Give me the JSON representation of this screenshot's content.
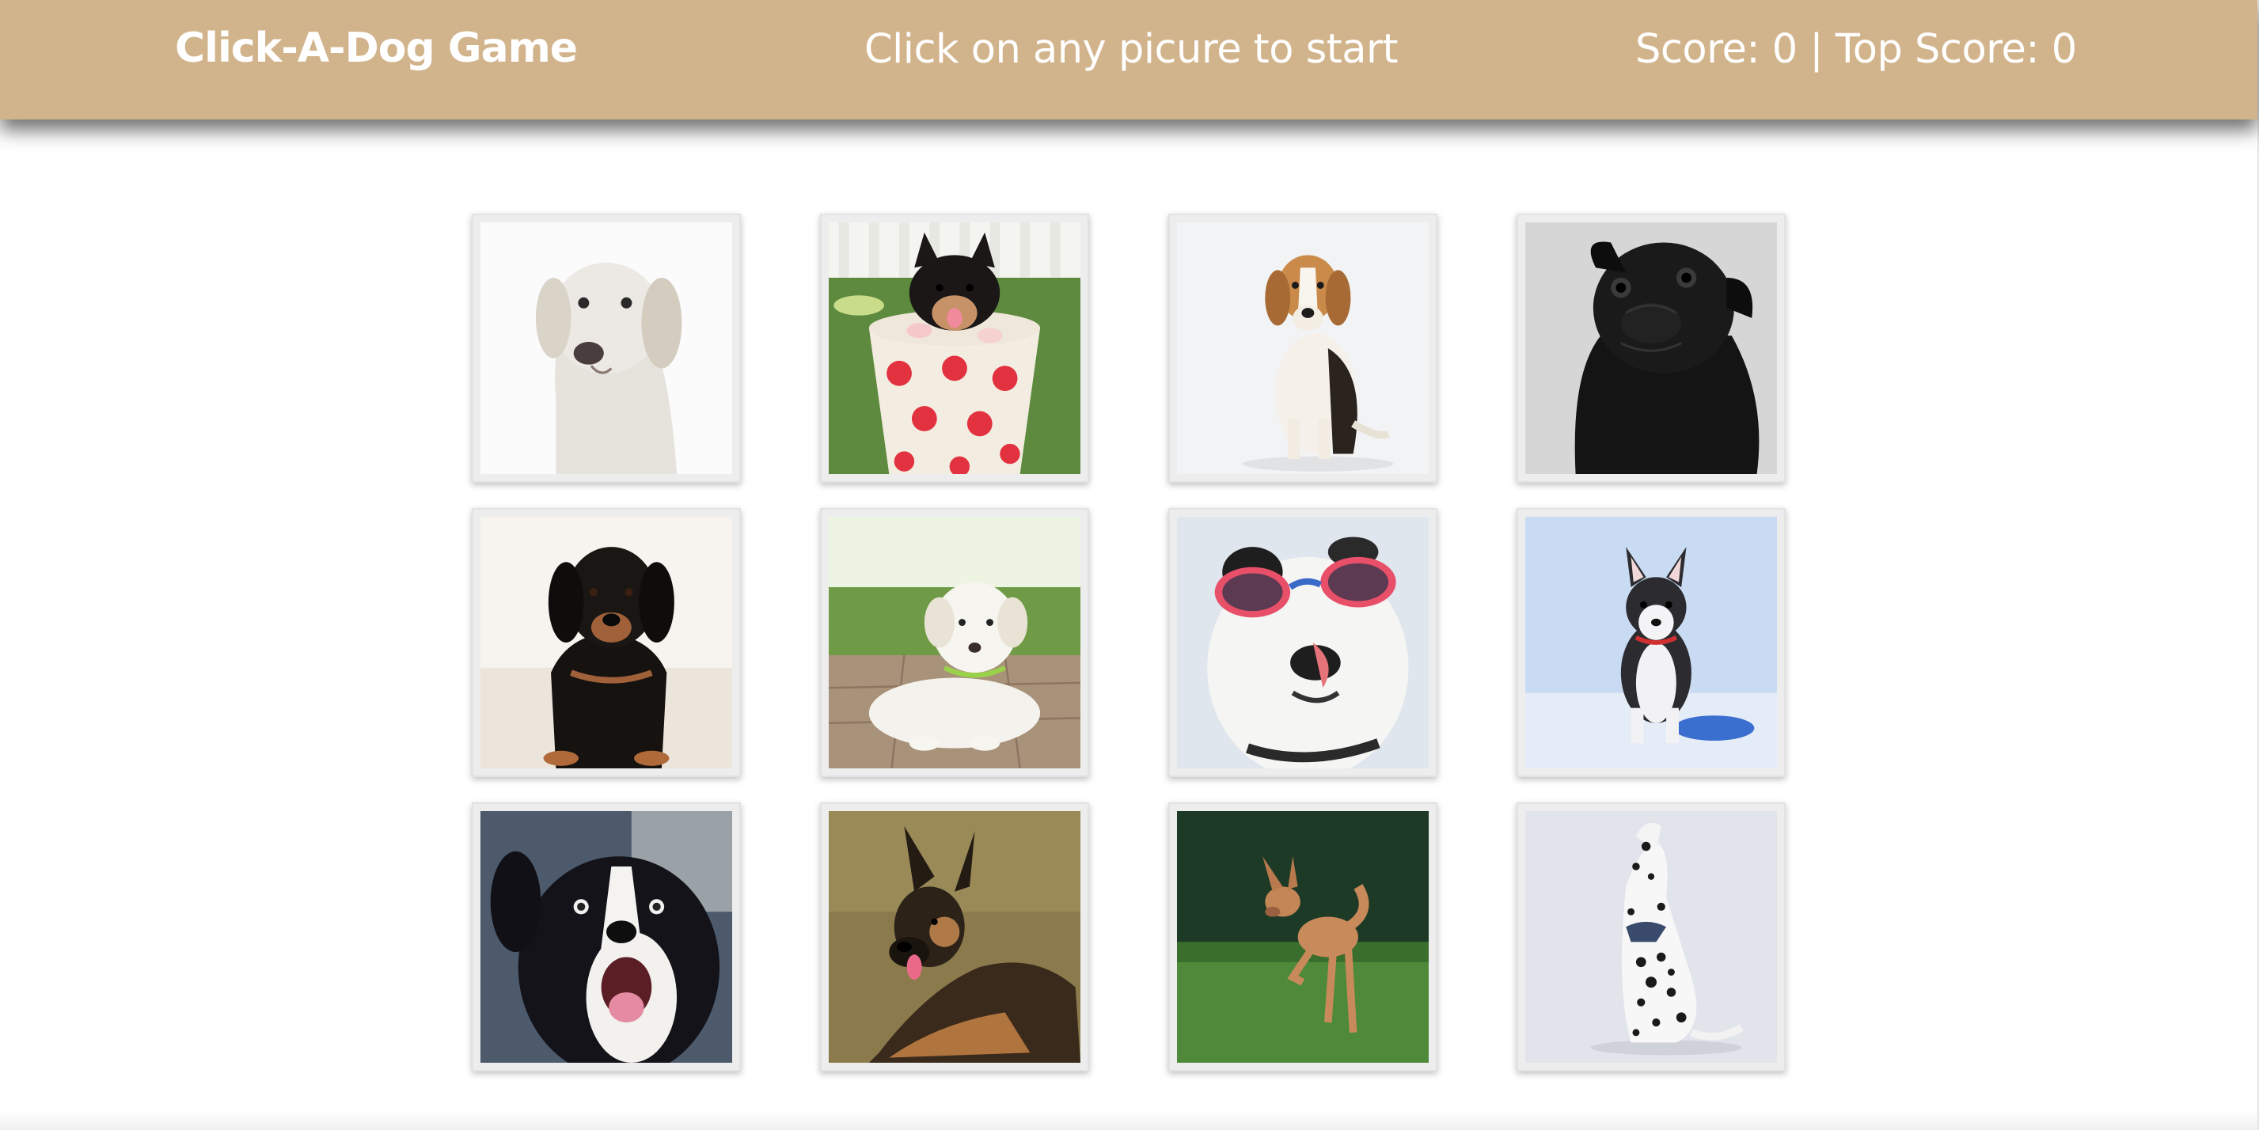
{
  "navbar": {
    "brand": "Click-A-Dog Game",
    "message": "Click on any picure to start",
    "score_label": "Score: 0 | Top Score: 0"
  },
  "colors": {
    "navbar_bg": "#d2b48c",
    "navbar_text": "#ffffff",
    "card_border": "#e2e2e2"
  },
  "cards": [
    {
      "icon": "golden-retriever-photo"
    },
    {
      "icon": "puppy-in-polka-dot-cup-photo"
    },
    {
      "icon": "beagle-photo"
    },
    {
      "icon": "black-pug-photo"
    },
    {
      "icon": "dachshund-puppy-photo"
    },
    {
      "icon": "white-labrador-puppy-photo"
    },
    {
      "icon": "dog-with-sunglasses-photo"
    },
    {
      "icon": "husky-puppy-in-snow-photo"
    },
    {
      "icon": "border-collie-photo"
    },
    {
      "icon": "german-shepherd-photo"
    },
    {
      "icon": "jumping-tan-dog-photo"
    },
    {
      "icon": "dalmatian-photo"
    }
  ]
}
